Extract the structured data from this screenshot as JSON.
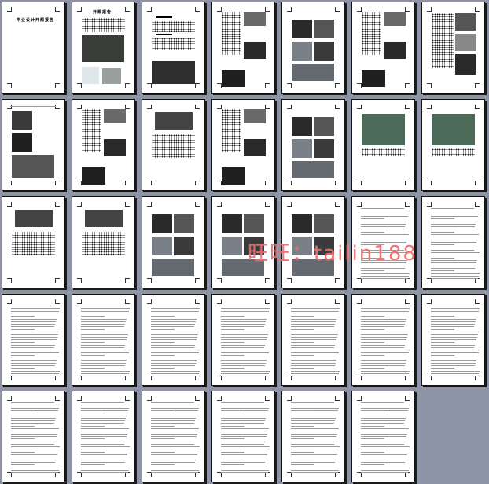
{
  "watermark": "旺旺：tailin188",
  "cover_title": "毕业设计开题报告",
  "page2_title": "开题报告",
  "colors": {
    "background": "#8d94a6",
    "page": "#ffffff",
    "watermark": "#f05a5a"
  }
}
